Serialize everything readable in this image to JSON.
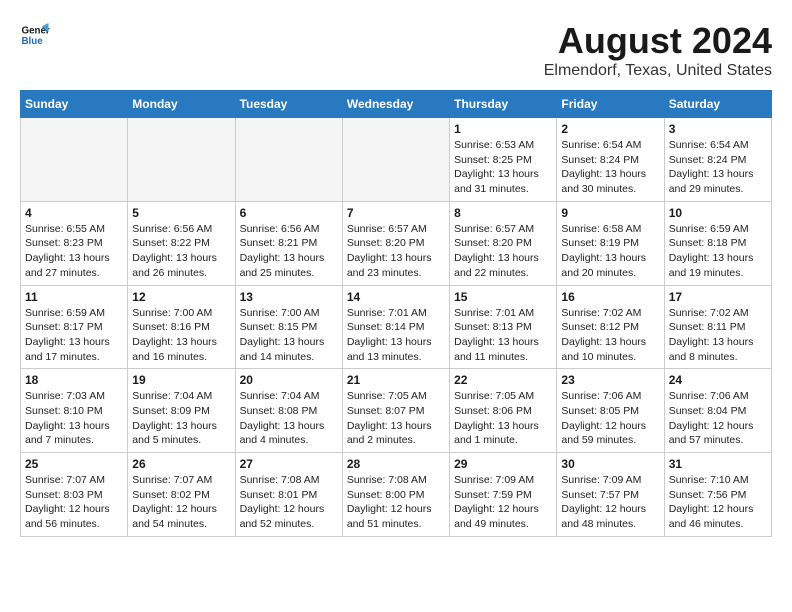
{
  "header": {
    "logo_line1": "General",
    "logo_line2": "Blue",
    "month_year": "August 2024",
    "location": "Elmendorf, Texas, United States"
  },
  "weekdays": [
    "Sunday",
    "Monday",
    "Tuesday",
    "Wednesday",
    "Thursday",
    "Friday",
    "Saturday"
  ],
  "weeks": [
    [
      {
        "day": "",
        "info": ""
      },
      {
        "day": "",
        "info": ""
      },
      {
        "day": "",
        "info": ""
      },
      {
        "day": "",
        "info": ""
      },
      {
        "day": "1",
        "info": "Sunrise: 6:53 AM\nSunset: 8:25 PM\nDaylight: 13 hours\nand 31 minutes."
      },
      {
        "day": "2",
        "info": "Sunrise: 6:54 AM\nSunset: 8:24 PM\nDaylight: 13 hours\nand 30 minutes."
      },
      {
        "day": "3",
        "info": "Sunrise: 6:54 AM\nSunset: 8:24 PM\nDaylight: 13 hours\nand 29 minutes."
      }
    ],
    [
      {
        "day": "4",
        "info": "Sunrise: 6:55 AM\nSunset: 8:23 PM\nDaylight: 13 hours\nand 27 minutes."
      },
      {
        "day": "5",
        "info": "Sunrise: 6:56 AM\nSunset: 8:22 PM\nDaylight: 13 hours\nand 26 minutes."
      },
      {
        "day": "6",
        "info": "Sunrise: 6:56 AM\nSunset: 8:21 PM\nDaylight: 13 hours\nand 25 minutes."
      },
      {
        "day": "7",
        "info": "Sunrise: 6:57 AM\nSunset: 8:20 PM\nDaylight: 13 hours\nand 23 minutes."
      },
      {
        "day": "8",
        "info": "Sunrise: 6:57 AM\nSunset: 8:20 PM\nDaylight: 13 hours\nand 22 minutes."
      },
      {
        "day": "9",
        "info": "Sunrise: 6:58 AM\nSunset: 8:19 PM\nDaylight: 13 hours\nand 20 minutes."
      },
      {
        "day": "10",
        "info": "Sunrise: 6:59 AM\nSunset: 8:18 PM\nDaylight: 13 hours\nand 19 minutes."
      }
    ],
    [
      {
        "day": "11",
        "info": "Sunrise: 6:59 AM\nSunset: 8:17 PM\nDaylight: 13 hours\nand 17 minutes."
      },
      {
        "day": "12",
        "info": "Sunrise: 7:00 AM\nSunset: 8:16 PM\nDaylight: 13 hours\nand 16 minutes."
      },
      {
        "day": "13",
        "info": "Sunrise: 7:00 AM\nSunset: 8:15 PM\nDaylight: 13 hours\nand 14 minutes."
      },
      {
        "day": "14",
        "info": "Sunrise: 7:01 AM\nSunset: 8:14 PM\nDaylight: 13 hours\nand 13 minutes."
      },
      {
        "day": "15",
        "info": "Sunrise: 7:01 AM\nSunset: 8:13 PM\nDaylight: 13 hours\nand 11 minutes."
      },
      {
        "day": "16",
        "info": "Sunrise: 7:02 AM\nSunset: 8:12 PM\nDaylight: 13 hours\nand 10 minutes."
      },
      {
        "day": "17",
        "info": "Sunrise: 7:02 AM\nSunset: 8:11 PM\nDaylight: 13 hours\nand 8 minutes."
      }
    ],
    [
      {
        "day": "18",
        "info": "Sunrise: 7:03 AM\nSunset: 8:10 PM\nDaylight: 13 hours\nand 7 minutes."
      },
      {
        "day": "19",
        "info": "Sunrise: 7:04 AM\nSunset: 8:09 PM\nDaylight: 13 hours\nand 5 minutes."
      },
      {
        "day": "20",
        "info": "Sunrise: 7:04 AM\nSunset: 8:08 PM\nDaylight: 13 hours\nand 4 minutes."
      },
      {
        "day": "21",
        "info": "Sunrise: 7:05 AM\nSunset: 8:07 PM\nDaylight: 13 hours\nand 2 minutes."
      },
      {
        "day": "22",
        "info": "Sunrise: 7:05 AM\nSunset: 8:06 PM\nDaylight: 13 hours\nand 1 minute."
      },
      {
        "day": "23",
        "info": "Sunrise: 7:06 AM\nSunset: 8:05 PM\nDaylight: 12 hours\nand 59 minutes."
      },
      {
        "day": "24",
        "info": "Sunrise: 7:06 AM\nSunset: 8:04 PM\nDaylight: 12 hours\nand 57 minutes."
      }
    ],
    [
      {
        "day": "25",
        "info": "Sunrise: 7:07 AM\nSunset: 8:03 PM\nDaylight: 12 hours\nand 56 minutes."
      },
      {
        "day": "26",
        "info": "Sunrise: 7:07 AM\nSunset: 8:02 PM\nDaylight: 12 hours\nand 54 minutes."
      },
      {
        "day": "27",
        "info": "Sunrise: 7:08 AM\nSunset: 8:01 PM\nDaylight: 12 hours\nand 52 minutes."
      },
      {
        "day": "28",
        "info": "Sunrise: 7:08 AM\nSunset: 8:00 PM\nDaylight: 12 hours\nand 51 minutes."
      },
      {
        "day": "29",
        "info": "Sunrise: 7:09 AM\nSunset: 7:59 PM\nDaylight: 12 hours\nand 49 minutes."
      },
      {
        "day": "30",
        "info": "Sunrise: 7:09 AM\nSunset: 7:57 PM\nDaylight: 12 hours\nand 48 minutes."
      },
      {
        "day": "31",
        "info": "Sunrise: 7:10 AM\nSunset: 7:56 PM\nDaylight: 12 hours\nand 46 minutes."
      }
    ]
  ]
}
